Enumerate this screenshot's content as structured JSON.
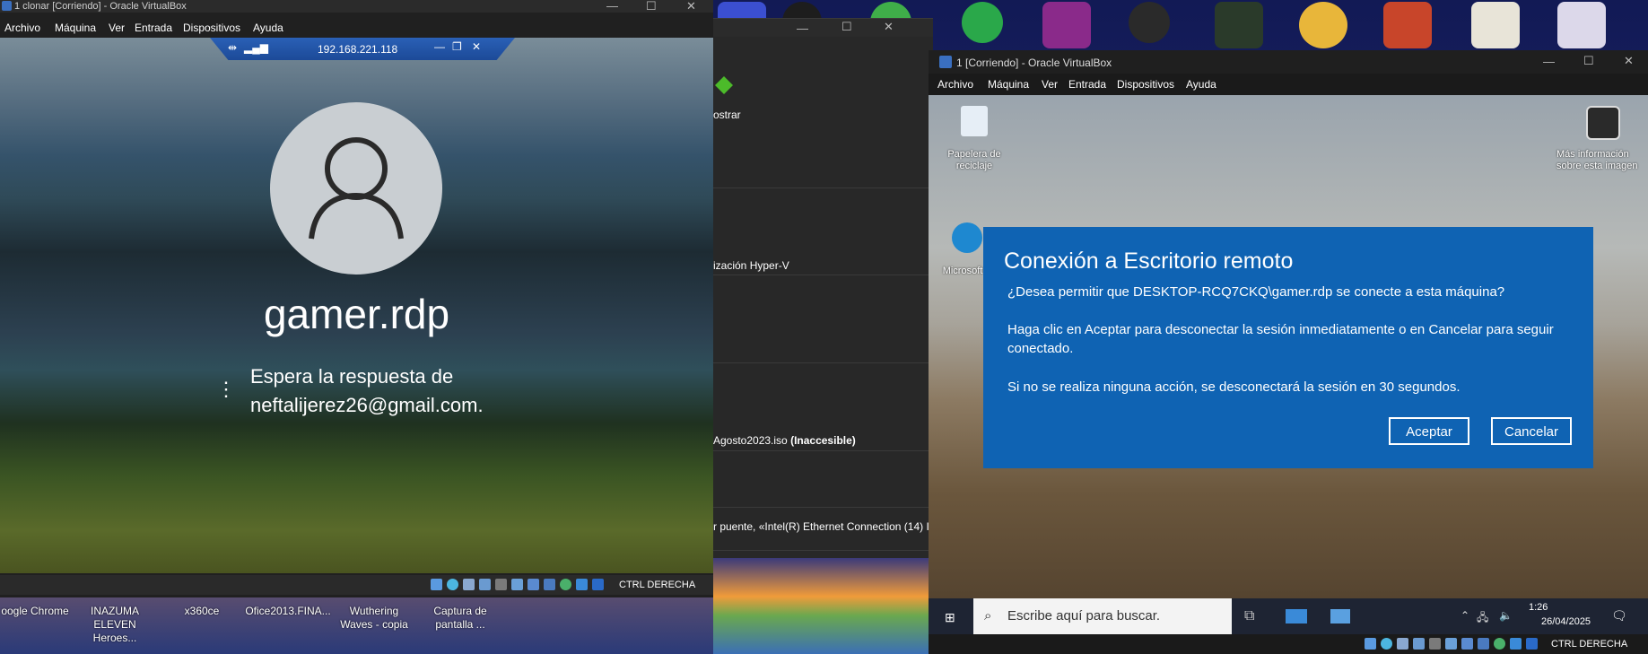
{
  "left_window": {
    "title": "1 clonar [Corriendo] - Oracle VirtualBox",
    "menu": [
      "Archivo",
      "Máquina",
      "Ver",
      "Entrada",
      "Dispositivos",
      "Ayuda"
    ],
    "rdp_bar_ip": "192.168.221.118",
    "lock_username": "gamer.rdp",
    "wait_line1": "Espera la respuesta de",
    "wait_line2": "neftalijerez26@gmail.com.",
    "host_key": "CTRL DERECHA"
  },
  "middle_manager": {
    "toolbar_label": "ostrar",
    "rows": [
      "",
      "ización Hyper-V",
      "",
      "Agosto2023.iso",
      "",
      "r puente, «Intel(R) Ethernet Connection (14) I"
    ],
    "inaccessible_label": "(Inaccesible)"
  },
  "host_desktop_icons": [
    {
      "label": "oogle Chrome"
    },
    {
      "label": "INAZUMA ELEVEN Heroes..."
    },
    {
      "label": "x360ce"
    },
    {
      "label": "Ofice2013.FINA..."
    },
    {
      "label": "Wuthering Waves - copia"
    },
    {
      "label": "Captura de pantalla ..."
    }
  ],
  "right_window": {
    "title": "1 [Corriendo] - Oracle VirtualBox",
    "menu": [
      "Archivo",
      "Máquina",
      "Ver",
      "Entrada",
      "Dispositivos",
      "Ayuda"
    ],
    "desktop_icons": {
      "recycle_bin": "Papelera de reciclaje",
      "edge": "Microsoft",
      "more_info": "Más información sobre esta imagen"
    },
    "dialog": {
      "title": "Conexión a Escritorio remoto",
      "question": "¿Desea permitir que DESKTOP-RCQ7CKQ\\gamer.rdp se conecte a esta máquina?",
      "instruction": "Haga clic en Aceptar para desconectar la sesión inmediatamente o en Cancelar para seguir conectado.",
      "timeout": "Si no se realiza ninguna acción, se desconectará la sesión en 30 segundos.",
      "accept_label": "Aceptar",
      "cancel_label": "Cancelar"
    },
    "taskbar": {
      "search_placeholder": "Escribe aquí para buscar.",
      "time": "1:26",
      "date": "26/04/2025"
    },
    "host_key": "CTRL DERECHA"
  },
  "colors": {
    "dialog_bg": "#0f63b3",
    "rdp_bar": "#2258ac"
  }
}
